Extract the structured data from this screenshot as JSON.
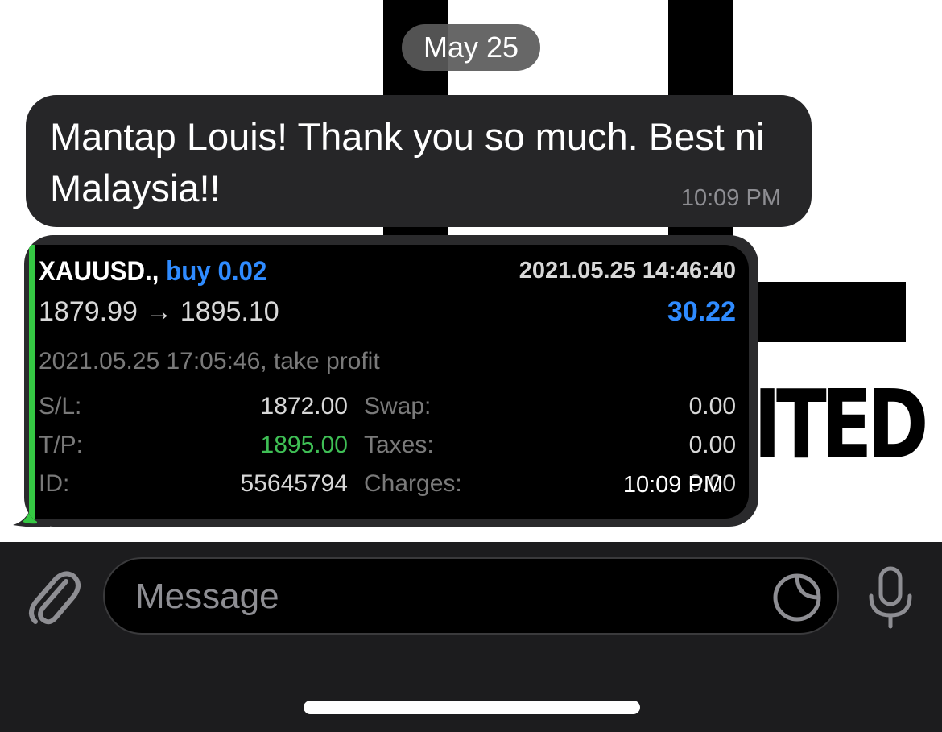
{
  "chat": {
    "date_label": "May 25",
    "messages": [
      {
        "text": "Mantap Louis! Thank you so much. Best ni Malaysia!!",
        "time": "10:09 PM"
      },
      {
        "type": "image",
        "time": "10:09 PM"
      }
    ]
  },
  "wallpaper": {
    "text": "ITED"
  },
  "trade": {
    "symbol": "XAUUSD.,",
    "side": "buy 0.02",
    "open_time": "2021.05.25 14:46:40",
    "prices": "1879.99 → 1895.10",
    "profit": "30.22",
    "close_info": "2021.05.25 17:05:46, take profit",
    "rows": [
      {
        "label": "S/L:",
        "value": "1872.00",
        "label2": "Swap:",
        "value2": "0.00"
      },
      {
        "label": "T/P:",
        "value": "1895.00",
        "label2": "Taxes:",
        "value2": "0.00"
      },
      {
        "label": "ID:",
        "value": "55645794",
        "label2": "Charges:",
        "value2": "0.00"
      }
    ]
  },
  "composer": {
    "placeholder": "Message"
  },
  "colors": {
    "bubble": "#262628",
    "accent_blue": "#2f8bff",
    "take_profit_green": "#3fbf55",
    "bar_background": "#1c1c1e"
  },
  "icons": [
    "paperclip-icon",
    "sticker-icon",
    "microphone-icon"
  ]
}
